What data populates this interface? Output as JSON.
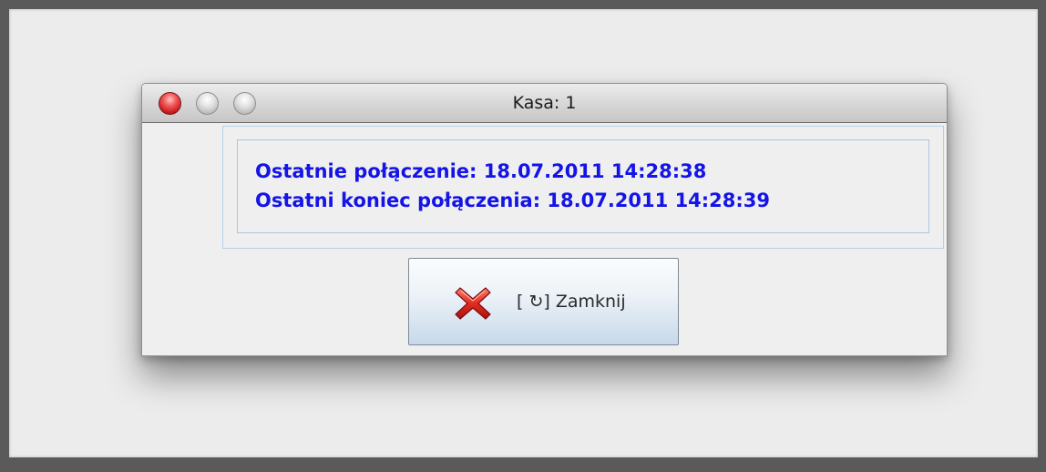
{
  "window": {
    "title": "Kasa: 1"
  },
  "info": {
    "last_connection": "Ostatnie połączenie: 18.07.2011 14:28:38",
    "last_disconnection": "Ostatni koniec połączenia: 18.07.2011 14:28:39"
  },
  "close_button": {
    "label": "[ ↻] Zamknij",
    "icon": "red-x-icon"
  },
  "colors": {
    "info_text": "#1414e6",
    "close_icon": "#d42020",
    "panel_border": "#a9c6e3"
  }
}
